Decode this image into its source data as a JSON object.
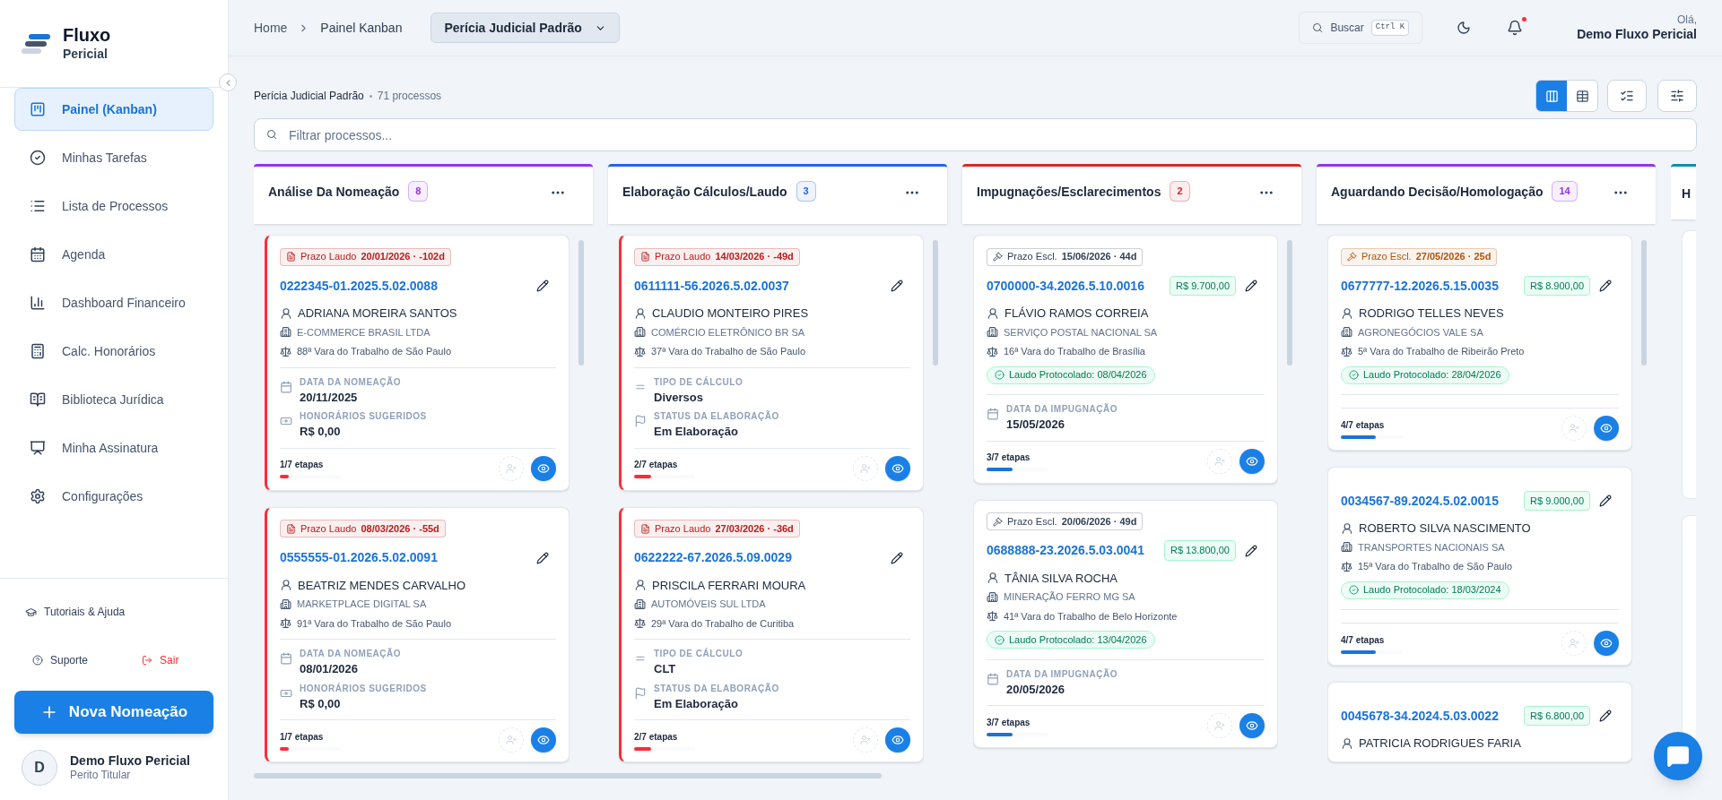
{
  "sidebar": {
    "logo": {
      "title": "Fluxo",
      "subtitle": "Pericial"
    },
    "nav": [
      {
        "label": "Painel (Kanban)",
        "selected": true
      },
      {
        "label": "Minhas Tarefas",
        "selected": false
      },
      {
        "label": "Lista de Processos",
        "selected": false
      },
      {
        "label": "Agenda",
        "selected": false
      },
      {
        "label": "Dashboard Financeiro",
        "selected": false
      },
      {
        "label": "Calc. Honorários",
        "selected": false
      },
      {
        "label": "Biblioteca Jurídica",
        "selected": false
      },
      {
        "label": "Minha Assinatura",
        "selected": false
      },
      {
        "label": "Configurações",
        "selected": false
      }
    ],
    "help_link": "Tutoriais & Ajuda",
    "support_link": "Suporte",
    "logout_link": "Sair",
    "primary_button": "Nova Nomeação",
    "user": {
      "initial": "D",
      "name": "Demo Fluxo Pericial",
      "role": "Perito Titular"
    }
  },
  "header": {
    "breadcrumbs": [
      "Home",
      "Painel Kanban"
    ],
    "board_select": "Perícia Judicial Padrão",
    "search": {
      "label": "Buscar",
      "shortcut": "Ctrl K"
    },
    "notifications": {
      "unread": true
    },
    "greeting": "Olá,",
    "user_name": "Demo Fluxo Pericial"
  },
  "board": {
    "title": "Perícia Judicial Padrão",
    "count": "71 processos",
    "view_toggle": [
      {
        "selected": true
      },
      {
        "selected": false
      }
    ],
    "filter": {
      "placeholder": "Filtrar processos..."
    }
  },
  "columns": [
    {
      "kind": "full",
      "title": "Análise Da Nomeação",
      "count": "8",
      "color": "#9333ea",
      "cards": [
        {
          "urgent": true,
          "deadline": {
            "kind": "laudo",
            "color": "#b91c1c",
            "label": "Prazo Laudo",
            "value": "20/01/2026 · -102d"
          },
          "number": "0222345-01.2025.5.02.0088",
          "party": "ADRIANA MOREIRA SANTOS",
          "company": "E-COMMERCE BRASIL LTDA",
          "court": "88ª Vara do Trabalho de São Paulo",
          "fields": [
            {
              "kind": "date",
              "label": "DATA DA NOMEAÇÃO",
              "value": "20/11/2025"
            },
            {
              "kind": "money",
              "label": "HONORÁRIOS SUGERIDOS",
              "value": "R$ 0,00"
            }
          ],
          "progress": {
            "label": "1/7 etapas",
            "level": 0.143
          }
        },
        {
          "urgent": true,
          "deadline": {
            "kind": "laudo",
            "color": "#b91c1c",
            "label": "Prazo Laudo",
            "value": "08/03/2026 · -55d"
          },
          "number": "0555555-01.2026.5.02.0091",
          "party": "BEATRIZ MENDES CARVALHO",
          "company": "MARKETPLACE DIGITAL SA",
          "court": "91ª Vara do Trabalho de São Paulo",
          "fields": [
            {
              "kind": "date",
              "label": "DATA DA NOMEAÇÃO",
              "value": "08/01/2026"
            },
            {
              "kind": "money",
              "label": "HONORÁRIOS SUGERIDOS",
              "value": "R$ 0,00"
            }
          ],
          "progress": {
            "label": "1/7 etapas",
            "level": 0.143
          }
        }
      ]
    },
    {
      "kind": "full",
      "title": "Elaboração Cálculos/Laudo",
      "count": "3",
      "color": "#2563eb",
      "cards": [
        {
          "urgent": true,
          "deadline": {
            "kind": "laudo",
            "color": "#b91c1c",
            "label": "Prazo Laudo",
            "value": "14/03/2026 · -49d"
          },
          "number": "0611111-56.2026.5.02.0037",
          "party": "CLAUDIO MONTEIRO PIRES",
          "company": "COMÉRCIO ELETRÔNICO BR SA",
          "court": "37ª Vara do Trabalho de São Paulo",
          "fields": [
            {
              "kind": "type",
              "label": "TIPO DE CÁLCULO",
              "value": "Diversos"
            },
            {
              "kind": "status",
              "label": "STATUS DA ELABORAÇÃO",
              "value": "Em Elaboração"
            }
          ],
          "progress": {
            "label": "2/7 etapas",
            "level": 0.286
          }
        },
        {
          "urgent": true,
          "deadline": {
            "kind": "laudo",
            "color": "#b91c1c",
            "label": "Prazo Laudo",
            "value": "27/03/2026 · -36d"
          },
          "number": "0622222-67.2026.5.09.0029",
          "party": "PRISCILA FERRARI MOURA",
          "company": "AUTOMÓVEIS SUL LTDA",
          "court": "29ª Vara do Trabalho de Curitiba",
          "fields": [
            {
              "kind": "type",
              "label": "TIPO DE CÁLCULO",
              "value": "CLT"
            },
            {
              "kind": "status",
              "label": "STATUS DA ELABORAÇÃO",
              "value": "Em Elaboração"
            }
          ],
          "progress": {
            "label": "2/7 etapas",
            "level": 0.286
          }
        }
      ]
    },
    {
      "kind": "full",
      "title": "Impugnações/Esclarecimentos",
      "count": "2",
      "color": "#dc2626",
      "cards": [
        {
          "urgent": false,
          "deadline": {
            "kind": "escl",
            "color": "#334155",
            "label": "Prazo Escl.",
            "value": "15/06/2026 · 44d"
          },
          "number": "0700000-34.2026.5.10.0016",
          "amount": "R$ 9.700,00",
          "party": "FLÁVIO RAMOS CORREIA",
          "company": "SERVIÇO POSTAL NACIONAL SA",
          "court": "16ª Vara do Trabalho de Brasília",
          "protocol": "Laudo Protocolado: 08/04/2026",
          "fields": [
            {
              "kind": "date",
              "label": "DATA DA IMPUGNAÇÃO",
              "value": "15/05/2026"
            }
          ],
          "progress": {
            "label": "3/7 etapas",
            "level": 0.429
          }
        },
        {
          "urgent": false,
          "deadline": {
            "kind": "escl",
            "color": "#334155",
            "label": "Prazo Escl.",
            "value": "20/06/2026 · 49d"
          },
          "number": "0688888-23.2026.5.03.0041",
          "amount": "R$ 13.800,00",
          "party": "TÂNIA SILVA ROCHA",
          "company": "MINERAÇÃO FERRO MG SA",
          "court": "41ª Vara do Trabalho de Belo Horizonte",
          "protocol": "Laudo Protocolado: 13/04/2026",
          "fields": [
            {
              "kind": "date",
              "label": "DATA DA IMPUGNAÇÃO",
              "value": "20/05/2026"
            }
          ],
          "progress": {
            "label": "3/7 etapas",
            "level": 0.429
          }
        }
      ]
    },
    {
      "kind": "full",
      "title": "Aguardando Decisão/Homologação",
      "count": "14",
      "color": "#9333ea",
      "cards": [
        {
          "urgent": false,
          "deadline": {
            "kind": "escl",
            "color": "#b45309",
            "label": "Prazo Escl.",
            "value": "27/05/2026 · 25d"
          },
          "number": "0677777-12.2026.5.15.0035",
          "amount": "R$ 8.900,00",
          "party": "RODRIGO TELLES NEVES",
          "company": "AGRONEGÓCIOS VALE SA",
          "court": "5ª Vara do Trabalho de Ribeirão Preto",
          "protocol": "Laudo Protocolado: 28/04/2026",
          "progress": {
            "label": "4/7 etapas",
            "level": 0.571
          }
        },
        {
          "urgent": false,
          "number": "0034567-89.2024.5.02.0015",
          "amount": "R$ 9.000,00",
          "party": "ROBERTO SILVA NASCIMENTO",
          "company": "TRANSPORTES NACIONAIS SA",
          "court": "15ª Vara do Trabalho de São Paulo",
          "protocol": "Laudo Protocolado: 18/03/2024",
          "progress": {
            "label": "4/7 etapas",
            "level": 0.571
          }
        },
        {
          "urgent": false,
          "number": "0045678-34.2024.5.03.0022",
          "amount": "R$ 6.800,00",
          "party": "PATRICIA RODRIGUES FARIA"
        }
      ]
    },
    {
      "kind": "partial",
      "title": "H",
      "color": "#0891b2"
    }
  ]
}
